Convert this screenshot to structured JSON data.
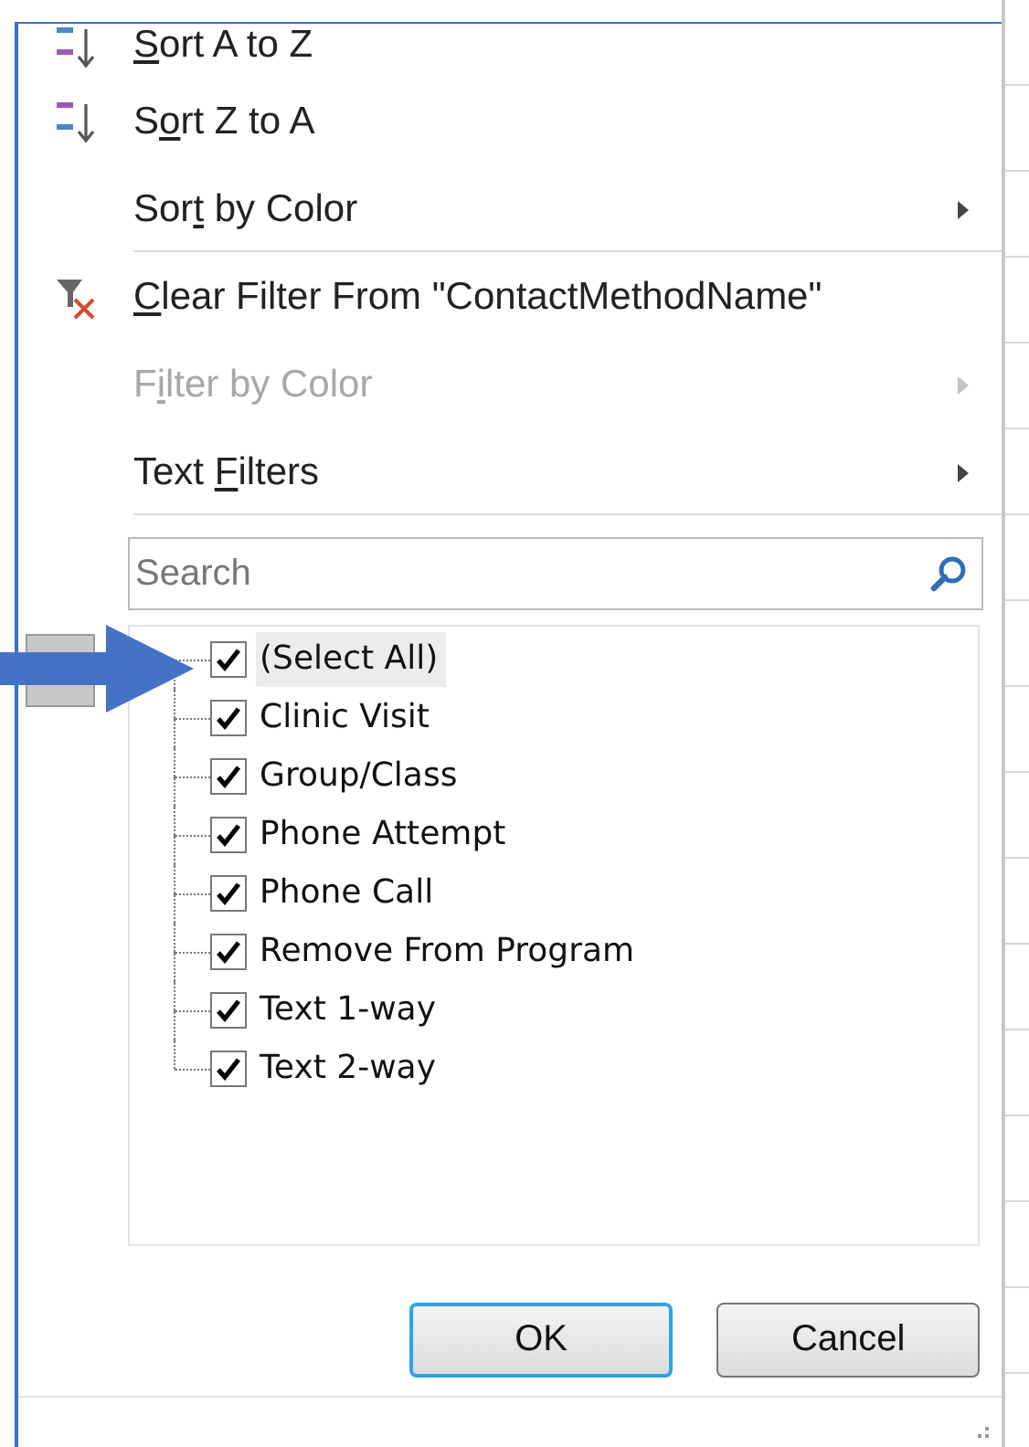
{
  "menu_items": [
    {
      "kind": "sort_az",
      "label": {
        "key": "S",
        "after": "ort A to Z"
      },
      "disabled": false,
      "submenu": false,
      "separator_after": false
    },
    {
      "kind": "sort_za",
      "label": {
        "before": "S",
        "key": "o",
        "after": "rt Z to A"
      },
      "disabled": false,
      "submenu": false,
      "separator_after": false
    },
    {
      "kind": "plain",
      "label": {
        "before": "Sor",
        "key": "t",
        "after": " by Color"
      },
      "disabled": false,
      "submenu": true,
      "separator_after": true
    },
    {
      "kind": "clear_filter",
      "label": {
        "key": "C",
        "after": "lear Filter From \"ContactMethodName\""
      },
      "disabled": false,
      "submenu": false,
      "separator_after": false
    },
    {
      "kind": "plain",
      "label": {
        "before": "F",
        "key": "i",
        "after": "lter by Color"
      },
      "disabled": true,
      "submenu": true,
      "separator_after": false
    },
    {
      "kind": "plain",
      "label": {
        "before": "Text ",
        "key": "F",
        "after": "ilters"
      },
      "disabled": false,
      "submenu": true,
      "separator_after": true
    }
  ],
  "search": {
    "placeholder": "Search"
  },
  "values": [
    {
      "label": "(Select All)",
      "checked": true,
      "selected": true
    },
    {
      "label": "Clinic Visit",
      "checked": true,
      "selected": false
    },
    {
      "label": "Group/Class",
      "checked": true,
      "selected": false
    },
    {
      "label": "Phone Attempt",
      "checked": true,
      "selected": false
    },
    {
      "label": "Phone Call",
      "checked": true,
      "selected": false
    },
    {
      "label": "Remove From Program",
      "checked": true,
      "selected": false
    },
    {
      "label": "Text 1-way",
      "checked": true,
      "selected": false
    },
    {
      "label": "Text 2-way",
      "checked": true,
      "selected": false
    }
  ],
  "buttons": [
    {
      "label": "OK",
      "default": true
    },
    {
      "label": "Cancel",
      "default": false
    }
  ]
}
